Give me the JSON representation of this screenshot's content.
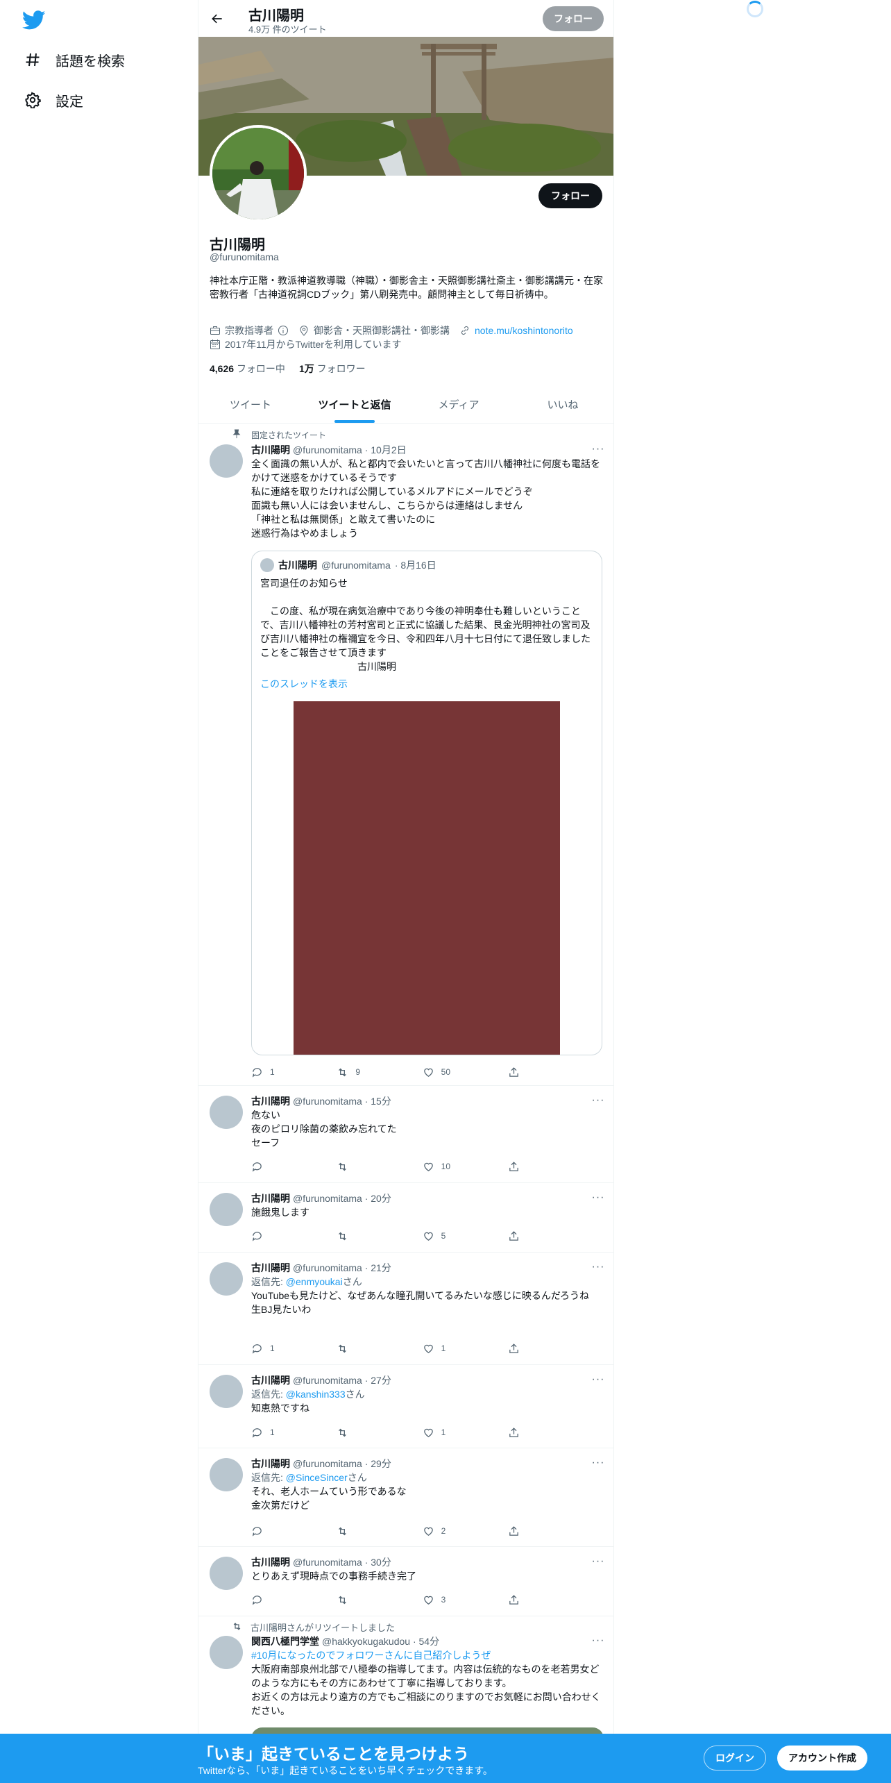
{
  "colors": {
    "accent": "#1d9bf0",
    "text": "#0f1419",
    "muted": "#536471"
  },
  "sidebar": {
    "logo": "twitter-bird-icon",
    "items": [
      {
        "label": "話題を検索",
        "icon": "hashtag-icon"
      },
      {
        "label": "設定",
        "icon": "gear-icon"
      }
    ]
  },
  "header": {
    "name": "古川陽明",
    "tweet_count": "4.9万 件のツイート",
    "follow_label": "フォロー"
  },
  "profile": {
    "name": "古川陽明",
    "handle": "@furunomitama",
    "follow_label": "フォロー",
    "bio": "神社本庁正階・教派神道教導職（神職）・御影舎主・天照御影講社斎主・御影講講元・在家密教行者「古神道祝詞CDブック」第八刷発売中。顧問神主として毎日祈祷中。",
    "category": "宗教指導者",
    "location": "御影舎・天照御影講社・御影講",
    "link": "note.mu/koshintonorito",
    "joined": "2017年11月からTwitterを利用しています",
    "following_count": "4,626",
    "following_label": "フォロー中",
    "followers_count": "1万",
    "followers_label": "フォロワー"
  },
  "tabs": [
    {
      "label": "ツイート"
    },
    {
      "label": "ツイートと返信"
    },
    {
      "label": "メディア"
    },
    {
      "label": "いいね"
    }
  ],
  "pinned_label": "固定されたツイート",
  "pinned": {
    "name": "古川陽明",
    "handle": "@furunomitama",
    "time": "· 10月2日",
    "text": "全く面識の無い人が、私と都内で会いたいと言って古川八幡神社に何度も電話をかけて迷惑をかけているそうです\n私に連絡を取りたければ公開しているメルアドにメールでどうぞ\n面識も無い人には会いませんし、こちらからは連絡はしません\n「神社と私は無関係」と敢えて書いたのに\n迷惑行為はやめましょう",
    "quote": {
      "name": "古川陽明",
      "handle": "@furunomitama",
      "time": "· 8月16日",
      "text": "宮司退任のお知らせ\n\n　この度、私が現在病気治療中であり今後の神明奉仕も難しいということで、吉川八幡神社の芳村宮司と正式に協議した結果、艮金光明神社の宮司及び吉川八幡神社の権禰宜を今日、令和四年八月十七日付にて退任致しましたことをご報告させて頂きます\n　　　　　　　　　　古川陽明",
      "thread_link": "このスレッドを表示"
    },
    "replies": "1",
    "retweets": "9",
    "likes": "50"
  },
  "tweets": [
    {
      "name": "古川陽明",
      "handle": "@furunomitama",
      "time": "· 15分",
      "reply_to": "",
      "reply_suffix": "",
      "text": "危ない\n夜のピロリ除菌の薬飲み忘れてた\nセーフ",
      "replies": "",
      "retweets": "",
      "likes": "10"
    },
    {
      "name": "古川陽明",
      "handle": "@furunomitama",
      "time": "· 20分",
      "reply_to": "",
      "reply_suffix": "",
      "text": "施餓鬼します",
      "replies": "",
      "retweets": "",
      "likes": "5"
    },
    {
      "name": "古川陽明",
      "handle": "@furunomitama",
      "time": "· 21分",
      "reply_prefix": "返信先: ",
      "reply_to": "@enmyoukai",
      "reply_suffix": "さん",
      "text": "YouTubeも見たけど、なぜあんな瞳孔開いてるみたいな感じに映るんだろうね\n生BJ見たいわ",
      "replies": "1",
      "retweets": "",
      "likes": "1"
    },
    {
      "name": "古川陽明",
      "handle": "@furunomitama",
      "time": "· 27分",
      "reply_prefix": "返信先: ",
      "reply_to": "@kanshin333",
      "reply_suffix": "さん",
      "text": "知恵熱ですね",
      "replies": "1",
      "retweets": "",
      "likes": "1"
    },
    {
      "name": "古川陽明",
      "handle": "@furunomitama",
      "time": "· 29分",
      "reply_prefix": "返信先: ",
      "reply_to": "@SinceSincer",
      "reply_suffix": "さん",
      "text": "それ、老人ホームていう形であるな\n金次第だけど",
      "replies": "",
      "retweets": "",
      "likes": "2"
    },
    {
      "name": "古川陽明",
      "handle": "@furunomitama",
      "time": "· 30分",
      "reply_to": "",
      "reply_suffix": "",
      "text": "とりあえず現時点での事務手続き完了",
      "replies": "",
      "retweets": "",
      "likes": "3"
    }
  ],
  "retweet": {
    "label": "古川陽明さんがリツイートしました",
    "name": "関西八極門学堂",
    "handle": "@hakkyokugakudou",
    "time": "· 54分",
    "hashtag": "#10月になったのでフォロワーさんに自己紹介しようぜ",
    "text": "大阪府南部泉州北部で八極拳の指導してます。内容は伝統的なものを老若男女どのような方にもその方にあわせて丁寧に指導しております。\nお近くの方は元より遠方の方でもご相談にのりますのでお気軽にお問い合わせください。"
  },
  "bottom": {
    "title": "「いま」起きていることを見つけよう",
    "subtitle": "Twitterなら、「いま」起きていることをいち早くチェックできます。",
    "login": "ログイン",
    "signup": "アカウント作成"
  }
}
